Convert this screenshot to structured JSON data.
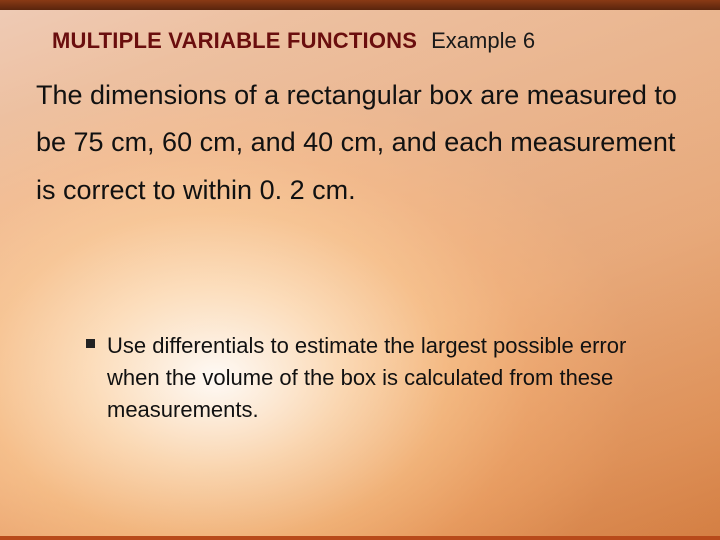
{
  "header": {
    "title": "MULTIPLE VARIABLE FUNCTIONS",
    "example_label": "Example 6"
  },
  "body": {
    "paragraph": "The dimensions of a rectangular box are measured to be 75 cm, 60 cm, and 40 cm, and each measurement is correct to within 0. 2 cm."
  },
  "bullets": [
    "Use differentials to estimate the largest possible error when the volume of the box is calculated from these measurements."
  ]
}
